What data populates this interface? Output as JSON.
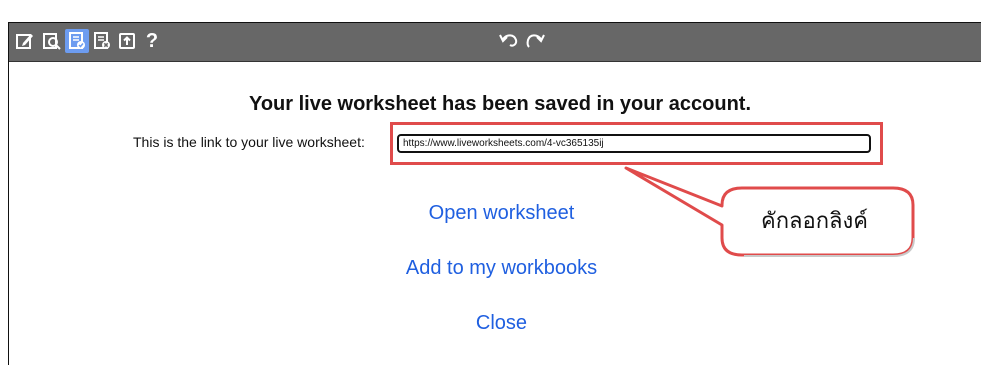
{
  "toolbar": {
    "icons": [
      "edit-icon",
      "preview-icon",
      "save-worksheet-icon",
      "delete-worksheet-icon",
      "export-icon",
      "help-icon",
      "undo-icon",
      "redo-icon"
    ],
    "help_label": "?",
    "background": "#676767",
    "active_highlight": "#6d9cf0"
  },
  "dialog": {
    "title": "Your live worksheet has been saved in your account.",
    "link_label": "This is the link to your live worksheet:",
    "link_value": "https://www.liveworksheets.com/4-vc365135ij",
    "open_label": "Open worksheet",
    "add_label": "Add to my workbooks",
    "close_label": "Close",
    "link_color": "#1f5fe0"
  },
  "annotation": {
    "callout_text": "คักลอกลิงค์",
    "border_color": "#e04b4b"
  }
}
